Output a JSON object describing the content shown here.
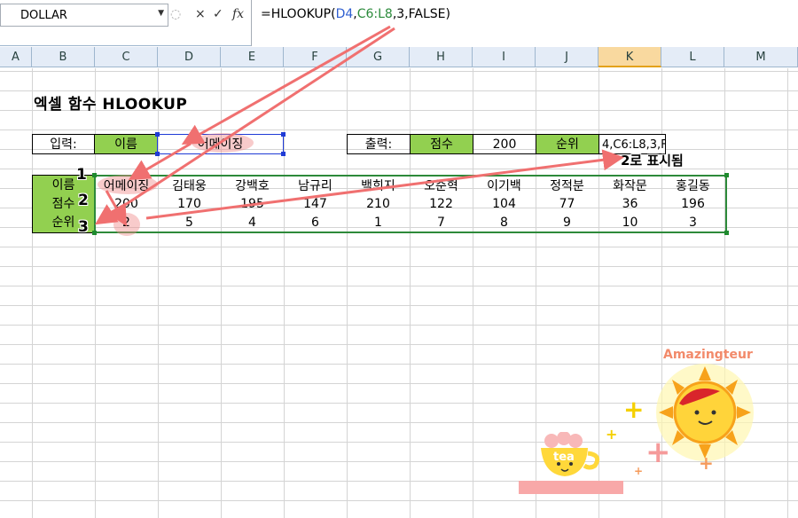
{
  "formula_bar": {
    "name_box": "DOLLAR",
    "cancel_icon": "×",
    "enter_icon": "✓",
    "fx_icon": "fx",
    "formula": {
      "prefix": "=HLOOKUP(",
      "ref1": "D4",
      "sep1": ",",
      "ref2": "C6:L8",
      "rest": ",3,FALSE)"
    }
  },
  "columns": [
    "A",
    "B",
    "C",
    "D",
    "E",
    "F",
    "G",
    "H",
    "I",
    "J",
    "K",
    "L",
    "M"
  ],
  "title": "엑셀 함수 HLOOKUP",
  "input": {
    "label": "입력:",
    "name_label": "이름",
    "value": "어메이징"
  },
  "output": {
    "label": "출력:",
    "score_label": "점수",
    "score_value": "200",
    "rank_label": "순위",
    "rank_formula": "4,C6:L8,3,F"
  },
  "table": {
    "row_labels": [
      "이름",
      "점수",
      "순위"
    ],
    "names": [
      "어메이징",
      "김태웅",
      "강백호",
      "남규리",
      "백희지",
      "오준혁",
      "이기백",
      "정적분",
      "화작문",
      "홍길동"
    ],
    "scores": [
      "200",
      "170",
      "195",
      "147",
      "210",
      "122",
      "104",
      "77",
      "36",
      "196"
    ],
    "ranks": [
      "2",
      "5",
      "4",
      "6",
      "1",
      "7",
      "8",
      "9",
      "10",
      "3"
    ]
  },
  "annotations": {
    "badges": [
      "1",
      "2",
      "3"
    ],
    "note": "2로 표시됨"
  },
  "decor": {
    "brand": "Amazingteur",
    "cup_text": "tea"
  },
  "colors": {
    "green": "#92d050",
    "arrow": "#f07070",
    "selected_col": "#f9d99f"
  }
}
